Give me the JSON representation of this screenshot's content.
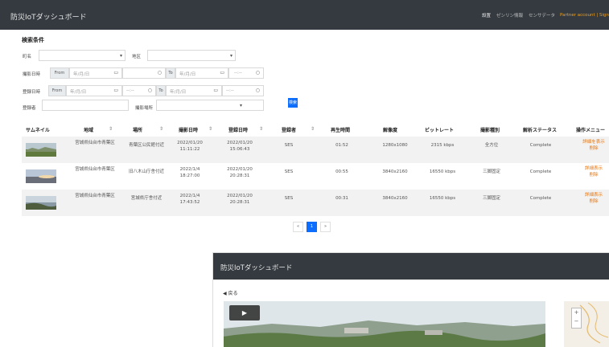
{
  "header": {
    "brand": "防災IoTダッシュボード",
    "links": [
      "設置",
      "ゼンリン情報",
      "センサデータ"
    ],
    "user": "Partner account | Sign"
  },
  "search": {
    "title": "検索条件",
    "labels": {
      "city": "町名",
      "area": "地区",
      "capture_date": "撮影日時",
      "register_date": "登録日時",
      "registrant": "登録者",
      "place_type": "撮影場所"
    },
    "from_label": "From",
    "to_label": "To",
    "date_placeholder": "年/月/日",
    "time_placeholder": "--:--",
    "button": "検索"
  },
  "table": {
    "columns": [
      "サムネイル",
      "地域",
      "場所",
      "撮影日時",
      "登録日時",
      "登録者",
      "再生時間",
      "解像度",
      "ビットレート",
      "撮影種別",
      "解析ステータス",
      "操作メニュー"
    ],
    "rows": [
      {
        "thumbnail": "landscape-thumbnail",
        "region": "宮城県仙台市青葉区",
        "place": "青葉区公民館付近",
        "capture_date": "2022/01/20 11:11:22",
        "register_date": "2022/01/20 15:06:43",
        "registrant": "SES",
        "duration": "01:52",
        "resolution": "1280x1080",
        "bitrate": "2315 kbps",
        "type": "全方位",
        "status": "Complete",
        "actions": [
          "詳細を表示",
          "削除"
        ]
      },
      {
        "thumbnail": "sunset-thumbnail",
        "region": "宮城県仙台市青葉区",
        "place": "旧八木山庁舎付近",
        "capture_date": "2022/1/4 18:27:00",
        "register_date": "2022/01/20 20:28:31",
        "registrant": "SES",
        "duration": "00:55",
        "resolution": "3840x2160",
        "bitrate": "16550 kbps",
        "type": "三脚固定",
        "status": "Complete",
        "actions": [
          "詳細表示",
          "削除"
        ]
      },
      {
        "thumbnail": "coast-thumbnail",
        "region": "宮城県仙台市青葉区",
        "place": "宮城県庁舎付近",
        "capture_date": "2022/1/4 17:43:52",
        "register_date": "2022/01/20 20:28:31",
        "registrant": "SES",
        "duration": "00:31",
        "resolution": "3840x2160",
        "bitrate": "16550 kbps",
        "type": "三脚固定",
        "status": "Complete",
        "actions": [
          "詳細表示",
          "削除"
        ]
      }
    ]
  },
  "pagination": {
    "prev": "«",
    "current": "1",
    "next": "»"
  },
  "popup": {
    "title": "防災IoTダッシュボード",
    "back": "◀ 戻る"
  },
  "colors": {
    "navbar": "#343a40",
    "accent": "#0d6efd",
    "action_link": "#e8740c",
    "user_link": "#f0a020"
  }
}
